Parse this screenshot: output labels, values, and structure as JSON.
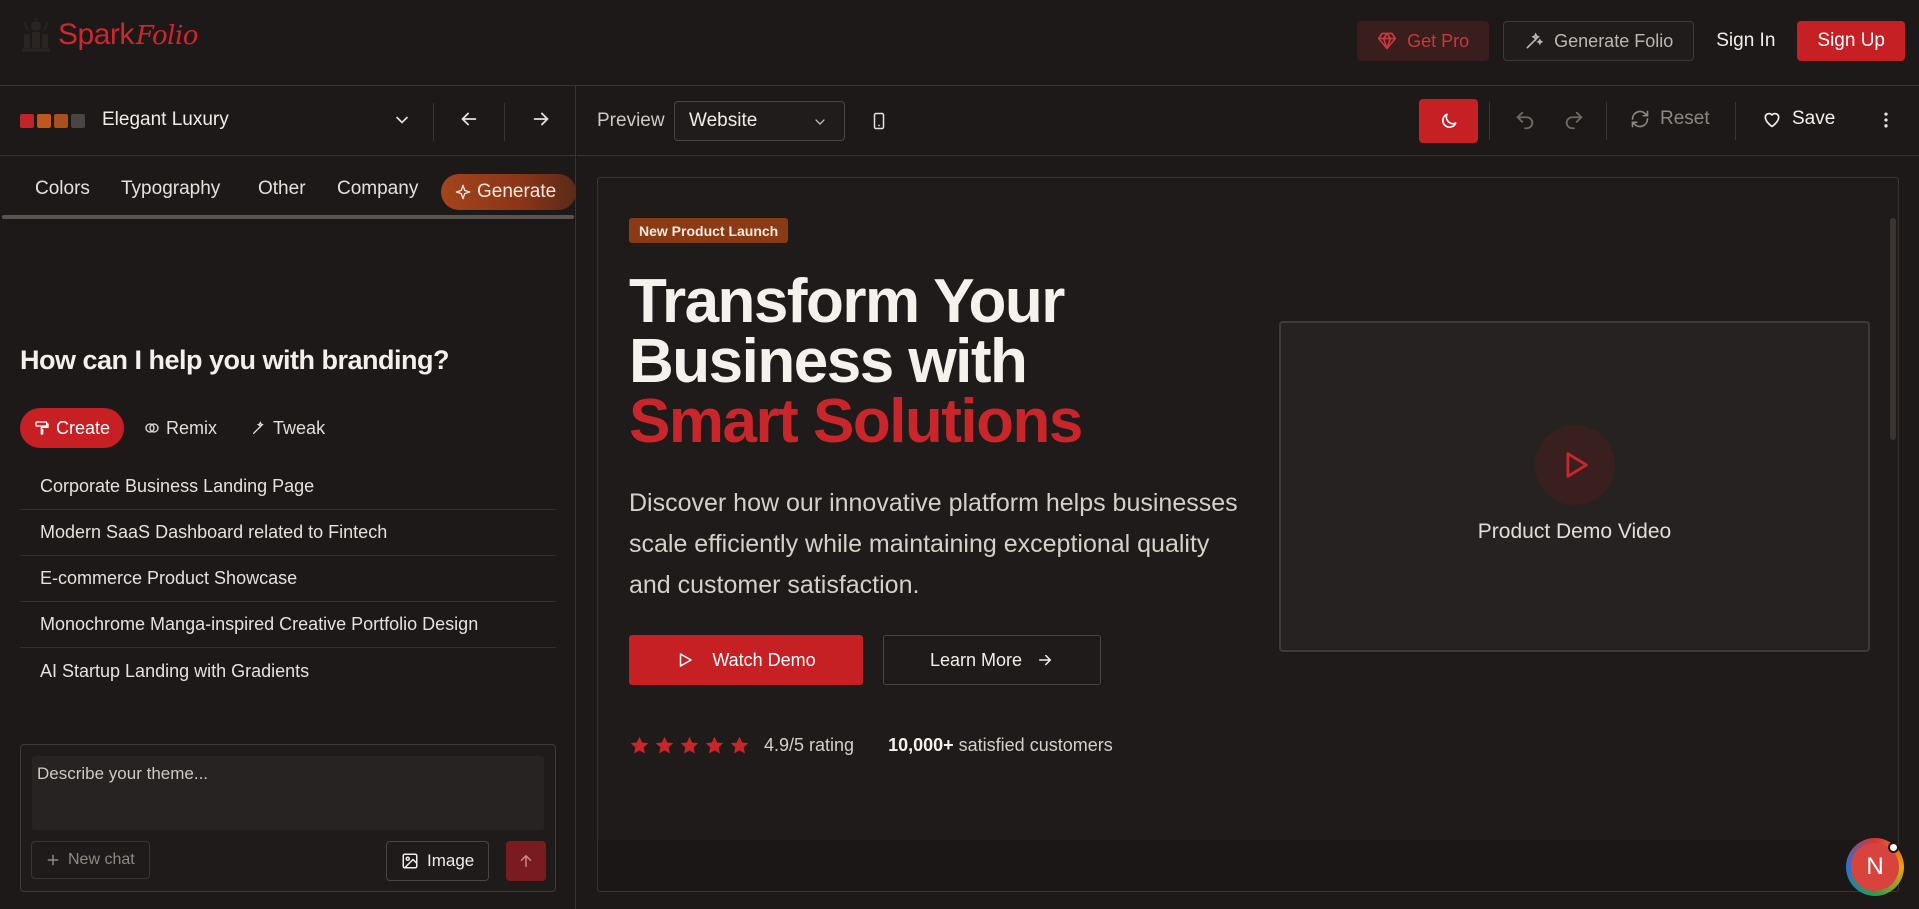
{
  "header": {
    "logo_spark": "Spark",
    "logo_folio": "Folio",
    "get_pro": "Get Pro",
    "generate_folio": "Generate Folio",
    "sign_in": "Sign In",
    "sign_up": "Sign Up"
  },
  "theme": {
    "name": "Elegant Luxury",
    "swatches": [
      "#c0252a",
      "#c0571c",
      "#a8501f",
      "#4a4542"
    ]
  },
  "tabs": {
    "colors": "Colors",
    "typography": "Typography",
    "other": "Other",
    "company": "Company",
    "generate": "Generate"
  },
  "assistant": {
    "title": "How can I help you with branding?",
    "modes": {
      "create": "Create",
      "remix": "Remix",
      "tweak": "Tweak"
    },
    "suggestions": [
      "Corporate Business Landing Page",
      "Modern SaaS Dashboard related to Fintech",
      "E-commerce Product Showcase",
      "Monochrome Manga-inspired Creative Portfolio Design",
      "AI Startup Landing with Gradients"
    ],
    "input_placeholder": "Describe your theme...",
    "new_chat": "New chat",
    "image": "Image"
  },
  "preview": {
    "label": "Preview",
    "mode": "Website",
    "reset": "Reset",
    "save": "Save"
  },
  "hero": {
    "badge": "New Product Launch",
    "title_line1": "Transform Your",
    "title_line2": "Business with",
    "title_line3": "Smart Solutions",
    "subtitle": "Discover how our innovative platform helps businesses scale efficiently while maintaining exceptional quality and customer satisfaction.",
    "watch_demo": "Watch Demo",
    "learn_more": "Learn More",
    "rating": "4.9/5 rating",
    "star_count": 5,
    "customers_count": "10,000+",
    "customers_text": "satisfied customers",
    "video_label": "Product Demo Video"
  },
  "user": {
    "avatar_initial": "N"
  },
  "colors": {
    "accent": "#c61f24",
    "background": "#1c1918",
    "badge": "#8a3b16"
  }
}
